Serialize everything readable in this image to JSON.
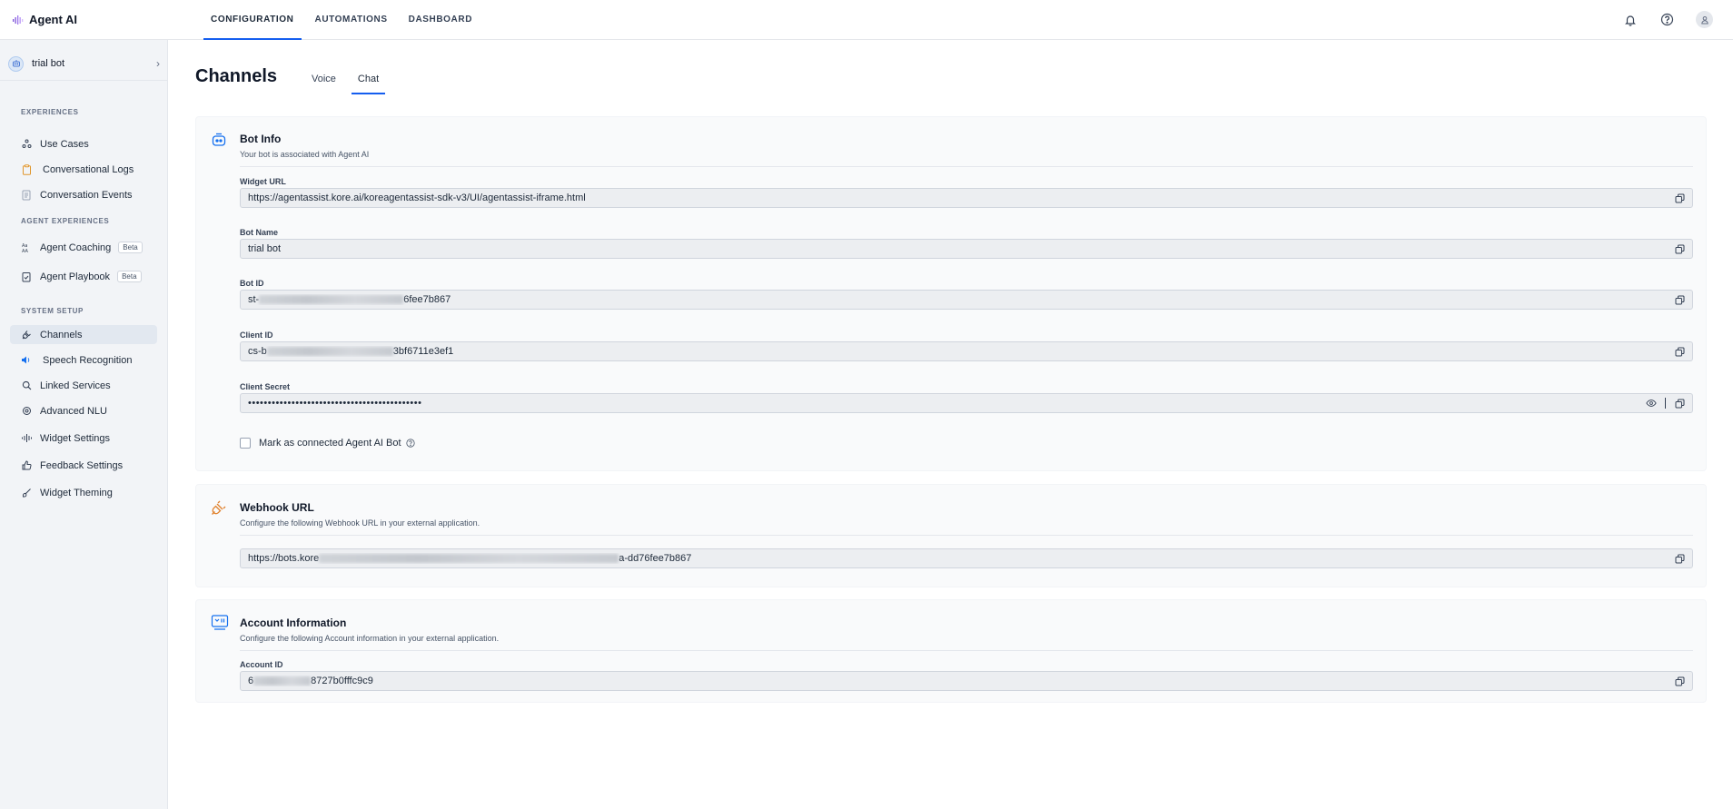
{
  "brand": {
    "name": "Agent AI"
  },
  "top_nav": {
    "tabs": [
      {
        "label": "CONFIGURATION"
      },
      {
        "label": "AUTOMATIONS"
      },
      {
        "label": "DASHBOARD"
      }
    ],
    "active_index": 0,
    "icons": [
      "bell-icon",
      "help-icon",
      "user-icon"
    ]
  },
  "sidebar": {
    "bot": {
      "name": "trial bot"
    },
    "sections": [
      {
        "title": "EXPERIENCES",
        "items": [
          {
            "label": "Use Cases",
            "icon": "use-cases-icon"
          },
          {
            "label": "Conversational Logs",
            "icon": "clipboard-icon"
          },
          {
            "label": "Conversation Events",
            "icon": "document-icon"
          }
        ]
      },
      {
        "title": "AGENT EXPERIENCES",
        "items": [
          {
            "label": "Agent Coaching",
            "icon": "coaching-icon",
            "badge": "Beta"
          },
          {
            "label": "Agent Playbook",
            "icon": "playbook-icon",
            "badge": "Beta"
          }
        ]
      },
      {
        "title": "SYSTEM SETUP",
        "items": [
          {
            "label": "Channels",
            "icon": "plug-icon",
            "active": true
          },
          {
            "label": "Speech Recognition",
            "icon": "speaker-icon"
          },
          {
            "label": "Linked Services",
            "icon": "search-icon"
          },
          {
            "label": "Advanced NLU",
            "icon": "brain-icon"
          },
          {
            "label": "Widget Settings",
            "icon": "waveform-icon"
          },
          {
            "label": "Feedback Settings",
            "icon": "thumbs-up-icon"
          },
          {
            "label": "Widget Theming",
            "icon": "brush-icon"
          }
        ]
      }
    ]
  },
  "page": {
    "title": "Channels",
    "tabs": [
      {
        "label": "Voice"
      },
      {
        "label": "Chat"
      }
    ],
    "active_tab": 1
  },
  "bot_info": {
    "title": "Bot Info",
    "description": "Your bot is associated with Agent AI",
    "fields": {
      "widget_url": {
        "label": "Widget URL",
        "value": "https://agentassist.kore.ai/koreagentassist-sdk-v3/UI/agentassist-iframe.html"
      },
      "bot_name": {
        "label": "Bot Name",
        "value": "trial bot"
      },
      "bot_id": {
        "label": "Bot ID",
        "prefix": "st-",
        "suffix": "6fee7b867"
      },
      "client_id": {
        "label": "Client ID",
        "prefix": "cs-b",
        "suffix": "3bf6711e3ef1"
      },
      "client_secret": {
        "label": "Client Secret",
        "value": "••••••••••••••••••••••••••••••••••••••••••••"
      }
    },
    "checkbox": {
      "label": "Mark as connected Agent AI Bot",
      "checked": false
    }
  },
  "webhook": {
    "title": "Webhook URL",
    "description": "Configure the following Webhook URL in your external application.",
    "url_prefix": "https://bots.kore",
    "url_suffix": "a-dd76fee7b867"
  },
  "account": {
    "title": "Account Information",
    "description": "Configure the following Account information in your external application.",
    "field": {
      "label": "Account ID",
      "prefix": "6",
      "suffix": "8727b0fffc9c9"
    }
  },
  "colors": {
    "accent": "#155eef",
    "sidebar_bg": "#f2f4f7",
    "card_bg": "#f9fafb",
    "field_bg": "#eceef1"
  }
}
